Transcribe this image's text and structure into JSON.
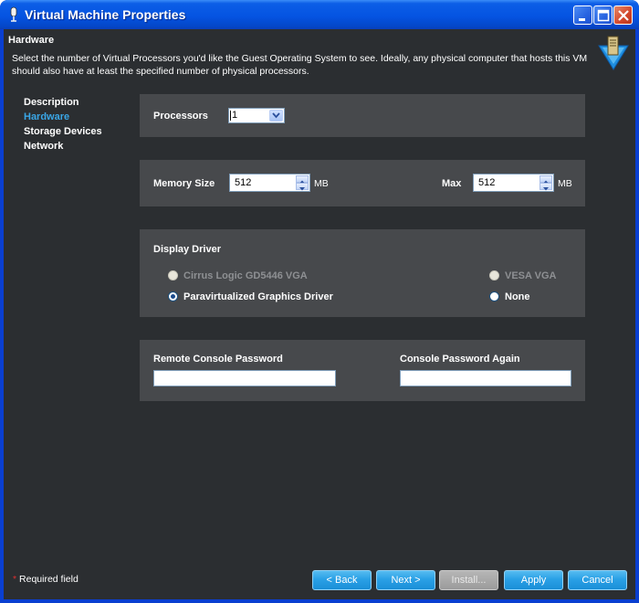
{
  "window": {
    "title": "Virtual Machine Properties",
    "title_icon": "microphone-icon",
    "controls": [
      "minimize-icon",
      "maximize-icon",
      "close-icon"
    ]
  },
  "header": {
    "title": "Hardware",
    "description": "Select the number of Virtual Processors you'd like the Guest Operating System to see. Ideally, any physical computer that hosts this VM should also have at least the specified number of physical processors.",
    "logo_icon": "server-diamond-icon"
  },
  "nav": {
    "items": [
      {
        "label": "Description",
        "active": false
      },
      {
        "label": "Hardware",
        "active": true
      },
      {
        "label": "Storage Devices",
        "active": false
      },
      {
        "label": "Network",
        "active": false
      }
    ]
  },
  "processors": {
    "label": "Processors",
    "value": "1"
  },
  "memory": {
    "size_label": "Memory Size",
    "size_value": "512",
    "size_unit": "MB",
    "max_label": "Max",
    "max_value": "512",
    "max_unit": "MB"
  },
  "display": {
    "label": "Display Driver",
    "options": [
      {
        "label": "Cirrus Logic GD5446 VGA",
        "selected": false,
        "enabled": false
      },
      {
        "label": "VESA VGA",
        "selected": false,
        "enabled": false
      },
      {
        "label": "Paravirtualized Graphics Driver",
        "selected": true,
        "enabled": true
      },
      {
        "label": "None",
        "selected": false,
        "enabled": true
      }
    ]
  },
  "password": {
    "label": "Remote Console Password",
    "value": "",
    "again_label": "Console Password Again",
    "again_value": ""
  },
  "footer": {
    "required_star": "*",
    "required_text": "Required field",
    "buttons": {
      "back": "< Back",
      "next": "Next >",
      "install": "Install...",
      "apply": "Apply",
      "cancel": "Cancel"
    }
  },
  "colors": {
    "background": "#2b2e31",
    "panel": "#47494c",
    "accent": "#3aa6e6",
    "titlebar": "#0554e2",
    "required": "#e03030"
  }
}
